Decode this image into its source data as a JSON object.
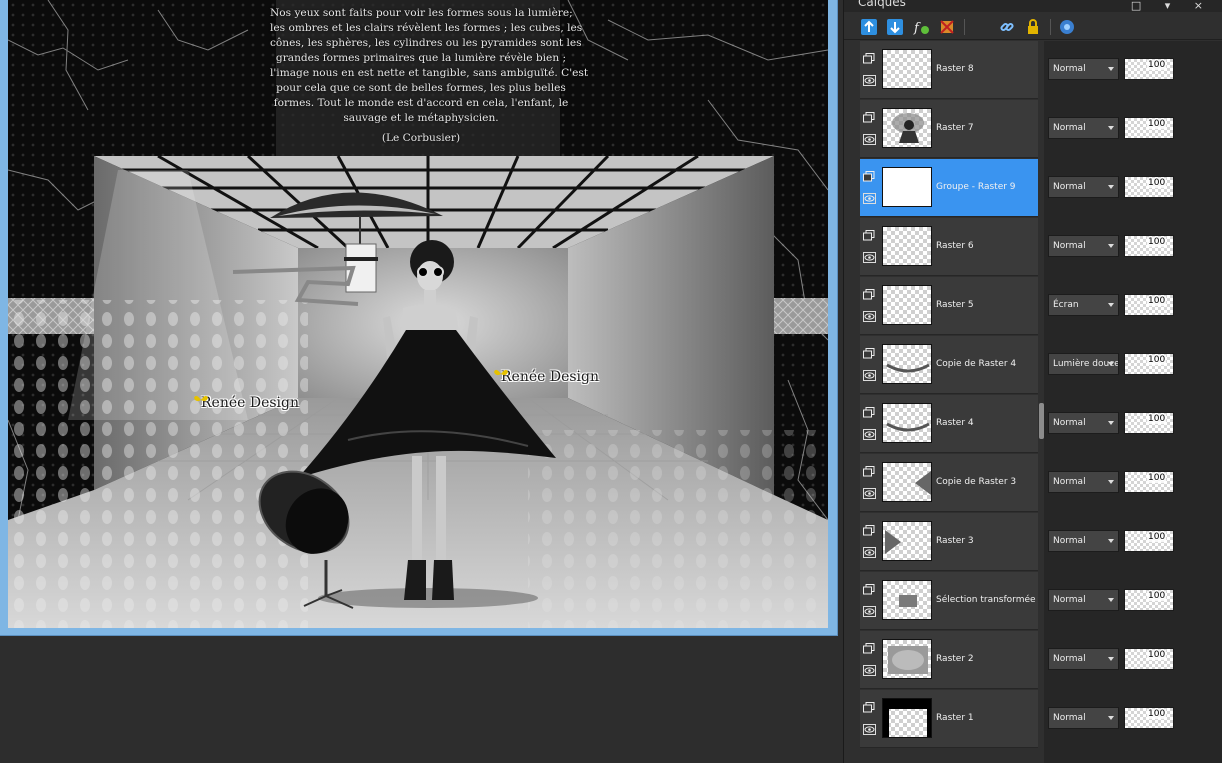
{
  "canvas": {
    "quote_lines": [
      "Nos yeux sont faits pour voir les formes sous la lumière;",
      "les ombres et les clairs révèlent les formes ; les cubes, les",
      "cônes, les sphères, les cylindres ou les pyramides sont les",
      "grandes formes primaires que la lumière révèle bien ;",
      "l'image nous en est nette et tangible, sans ambiguïté. C'est",
      "pour cela que ce sont de belles formes, les plus belles",
      "formes. Tout le monde est d'accord en cela, l'enfant, le",
      "sauvage et le métaphysicien."
    ],
    "quote_author": "(Le Corbusier)",
    "watermark_left": "Renée Design",
    "watermark_right": "Renée Design"
  },
  "layers_panel": {
    "title": "Calques",
    "header_controls": "□ ▾ ×",
    "toolbar_icons": [
      "new-layer-icon",
      "merge-down-icon",
      "layer-style-icon",
      "delete-layer-icon",
      "link-icon",
      "lock-icon",
      "view-options-icon"
    ],
    "layers": [
      {
        "name": "Raster 8",
        "blend": "Normal",
        "opacity": "100",
        "selected": false,
        "thumb": "empty"
      },
      {
        "name": "Raster 7",
        "blend": "Normal",
        "opacity": "100",
        "selected": false,
        "thumb": "figure"
      },
      {
        "name": "Groupe - Raster 9",
        "blend": "Normal",
        "opacity": "100",
        "selected": true,
        "thumb": "white"
      },
      {
        "name": "Raster 6",
        "blend": "Normal",
        "opacity": "100",
        "selected": false,
        "thumb": "empty"
      },
      {
        "name": "Raster 5",
        "blend": "Écran",
        "opacity": "100",
        "selected": false,
        "thumb": "empty"
      },
      {
        "name": "Copie de Raster 4",
        "blend": "Lumière douce",
        "opacity": "100",
        "selected": false,
        "thumb": "arc"
      },
      {
        "name": "Raster 4",
        "blend": "Normal",
        "opacity": "100",
        "selected": false,
        "thumb": "arc"
      },
      {
        "name": "Copie de Raster 3",
        "blend": "Normal",
        "opacity": "100",
        "selected": false,
        "thumb": "wedge-right"
      },
      {
        "name": "Raster 3",
        "blend": "Normal",
        "opacity": "100",
        "selected": false,
        "thumb": "wedge-left"
      },
      {
        "name": "Sélection transformée",
        "blend": "Normal",
        "opacity": "100",
        "selected": false,
        "thumb": "small-rect"
      },
      {
        "name": "Raster 2",
        "blend": "Normal",
        "opacity": "100",
        "selected": false,
        "thumb": "grey-rect"
      },
      {
        "name": "Raster 1",
        "blend": "Normal",
        "opacity": "100",
        "selected": false,
        "thumb": "black-frame"
      }
    ]
  }
}
